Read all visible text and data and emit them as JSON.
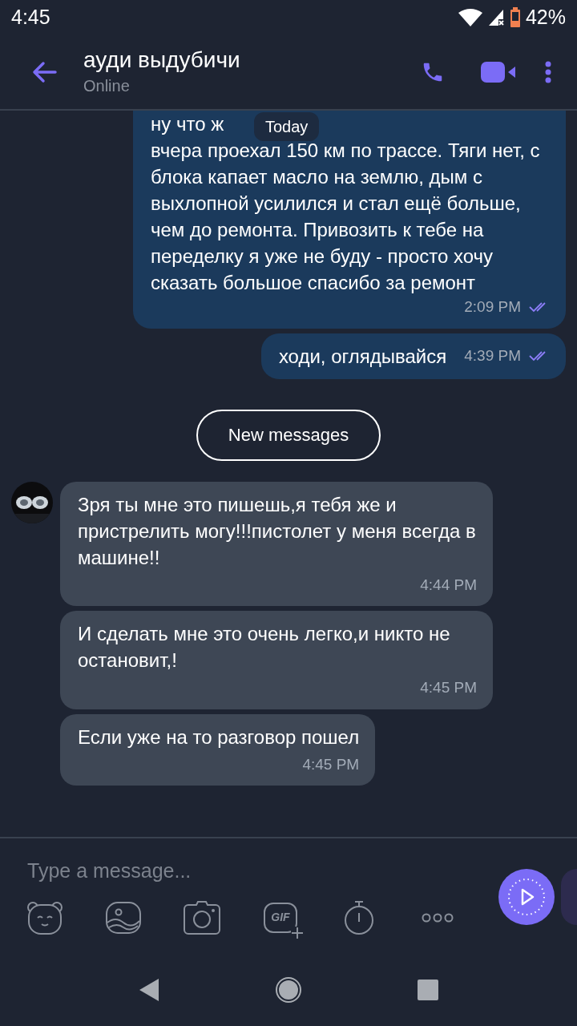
{
  "status_bar": {
    "time": "4:45",
    "battery": "42%"
  },
  "header": {
    "title": "ауди выдубичи",
    "subtitle": "Online"
  },
  "date_pill": "Today",
  "messages": [
    {
      "kind": "outgoing",
      "text": "ну что ж\nвчера проехал 150 км по трассе. Тяги нет, с блока капает масло на землю, дым с выхлопной усилился и стал ещё больше, чем до ремонта. Привозить к тебе на переделку я уже не буду - просто хочу сказать большое спасибо за ремонт",
      "time": "2:09 PM",
      "read": true
    },
    {
      "kind": "outgoing",
      "text": "ходи, оглядывайся",
      "time": "4:39 PM",
      "read": true
    },
    {
      "kind": "divider",
      "text": "New messages"
    },
    {
      "kind": "incoming",
      "text": "Зря ты мне это пишешь,я тебя же и пристрелить могу!!!пистолет у меня всегда в машине!!",
      "time": "4:44 PM",
      "avatar": true
    },
    {
      "kind": "incoming",
      "text": "И сделать мне это очень легко,и никто не остановит,!",
      "time": "4:45 PM",
      "avatar": false
    },
    {
      "kind": "incoming",
      "text": "Если уже на то разговор пошел",
      "time": "4:45 PM",
      "avatar": false
    }
  ],
  "composer": {
    "placeholder": "Type a message..."
  },
  "toolbar": [
    {
      "kind": "sticker"
    },
    {
      "kind": "gallery"
    },
    {
      "kind": "camera"
    },
    {
      "kind": "gif",
      "label": "GIF"
    },
    {
      "kind": "timer"
    },
    {
      "kind": "more"
    }
  ]
}
